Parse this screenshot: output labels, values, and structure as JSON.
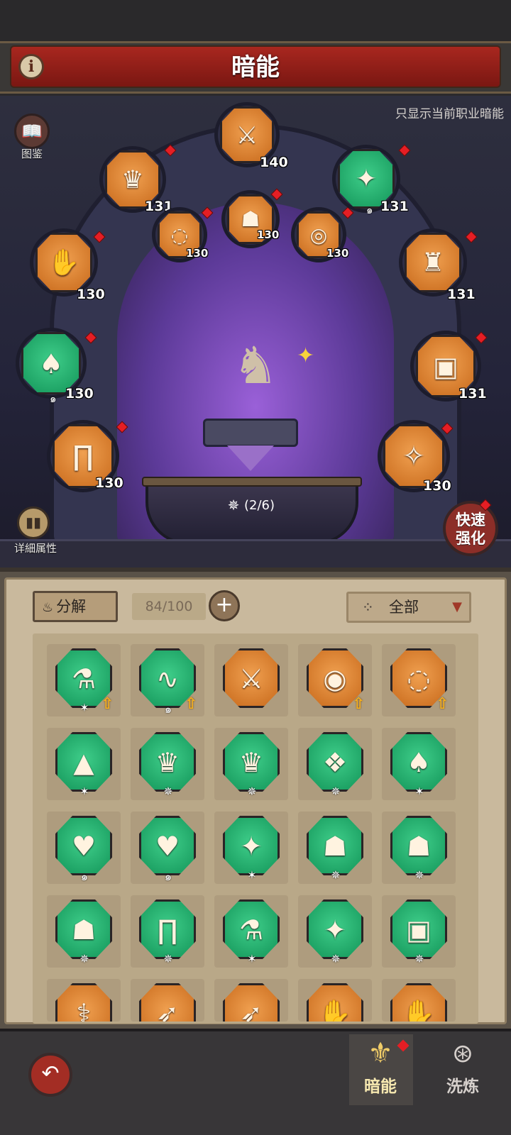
{
  "header": {
    "title": "暗能",
    "info_icon": "i"
  },
  "arena": {
    "show_job_only": "只显示当前职业暗能",
    "codex_label": "图鉴",
    "details_label": "详細属性",
    "quick_enhance": [
      "快速",
      "强化"
    ],
    "progress": "(2/6)"
  },
  "slots": [
    {
      "name": "slot-weapon",
      "level": "140",
      "color": "orange",
      "icon": "weapon-icon",
      "glyph": "⚔"
    },
    {
      "name": "slot-helmet",
      "level": "131",
      "color": "orange",
      "icon": "helmet-icon",
      "glyph": "♛"
    },
    {
      "name": "slot-accessory-1",
      "level": "130",
      "color": "orange",
      "icon": "bracelet-icon",
      "glyph": "◌"
    },
    {
      "name": "slot-accessory-2",
      "level": "130",
      "color": "orange",
      "icon": "mask-icon",
      "glyph": "☗"
    },
    {
      "name": "slot-accessory-3",
      "level": "130",
      "color": "orange",
      "icon": "ring-icon",
      "glyph": "◎"
    },
    {
      "name": "slot-shoulder",
      "level": "131",
      "color": "green",
      "icon": "shoulder-icon",
      "glyph": "✦"
    },
    {
      "name": "slot-chest",
      "level": "131",
      "color": "orange",
      "icon": "armor-icon",
      "glyph": "♜"
    },
    {
      "name": "slot-gloves",
      "level": "130",
      "color": "orange",
      "icon": "gloves-icon",
      "glyph": "✋"
    },
    {
      "name": "slot-cape",
      "level": "130",
      "color": "green",
      "icon": "cape-icon",
      "glyph": "♠"
    },
    {
      "name": "slot-belt",
      "level": "131",
      "color": "orange",
      "icon": "belt-icon",
      "glyph": "▣"
    },
    {
      "name": "slot-pants",
      "level": "130",
      "color": "orange",
      "icon": "pants-icon",
      "glyph": "∏"
    },
    {
      "name": "slot-boots",
      "level": "130",
      "color": "orange",
      "icon": "boots-icon",
      "glyph": "✧"
    }
  ],
  "inventory": {
    "decompose_label": "分解",
    "count": "84/100",
    "filter_label": "全部",
    "colors": {
      "orange": "#e8832e",
      "green": "#1fae6a"
    },
    "items": [
      {
        "color": "green",
        "glyph": "⚗",
        "badge": "✶",
        "upgrade": true
      },
      {
        "color": "green",
        "glyph": "∿",
        "badge": "๑",
        "upgrade": true
      },
      {
        "color": "orange",
        "glyph": "⚔",
        "badge": "",
        "upgrade": false
      },
      {
        "color": "orange",
        "glyph": "◉",
        "badge": "",
        "upgrade": true
      },
      {
        "color": "orange",
        "glyph": "◌",
        "badge": "",
        "upgrade": true
      },
      {
        "color": "green",
        "glyph": "▲",
        "badge": "✶",
        "upgrade": false
      },
      {
        "color": "green",
        "glyph": "♛",
        "badge": "✵",
        "upgrade": false
      },
      {
        "color": "green",
        "glyph": "♛",
        "badge": "✵",
        "upgrade": false
      },
      {
        "color": "green",
        "glyph": "❖",
        "badge": "✵",
        "upgrade": false
      },
      {
        "color": "green",
        "glyph": "♠",
        "badge": "✶",
        "upgrade": false
      },
      {
        "color": "green",
        "glyph": "♥",
        "badge": "๑",
        "upgrade": false
      },
      {
        "color": "green",
        "glyph": "♥",
        "badge": "๑",
        "upgrade": false
      },
      {
        "color": "green",
        "glyph": "✦",
        "badge": "✶",
        "upgrade": false
      },
      {
        "color": "green",
        "glyph": "☗",
        "badge": "✵",
        "upgrade": false
      },
      {
        "color": "green",
        "glyph": "☗",
        "badge": "✵",
        "upgrade": false
      },
      {
        "color": "green",
        "glyph": "☗",
        "badge": "✵",
        "upgrade": false
      },
      {
        "color": "green",
        "glyph": "∏",
        "badge": "✵",
        "upgrade": false
      },
      {
        "color": "green",
        "glyph": "⚗",
        "badge": "✶",
        "upgrade": false
      },
      {
        "color": "green",
        "glyph": "✦",
        "badge": "✵",
        "upgrade": false
      },
      {
        "color": "green",
        "glyph": "▣",
        "badge": "✵",
        "upgrade": false
      },
      {
        "color": "orange",
        "glyph": "⚕",
        "badge": "",
        "upgrade": false
      },
      {
        "color": "orange",
        "glyph": "➶",
        "badge": "",
        "upgrade": false
      },
      {
        "color": "orange",
        "glyph": "➶",
        "badge": "",
        "upgrade": false
      },
      {
        "color": "orange",
        "glyph": "✋",
        "badge": "",
        "upgrade": false
      },
      {
        "color": "orange",
        "glyph": "✋",
        "badge": "",
        "upgrade": false
      }
    ]
  },
  "bottom_nav": {
    "back_icon": "↶",
    "tabs": [
      {
        "label": "暗能",
        "icon": "dark-energy-icon",
        "active": true
      },
      {
        "label": "洗炼",
        "icon": "refine-icon",
        "active": false
      }
    ]
  }
}
